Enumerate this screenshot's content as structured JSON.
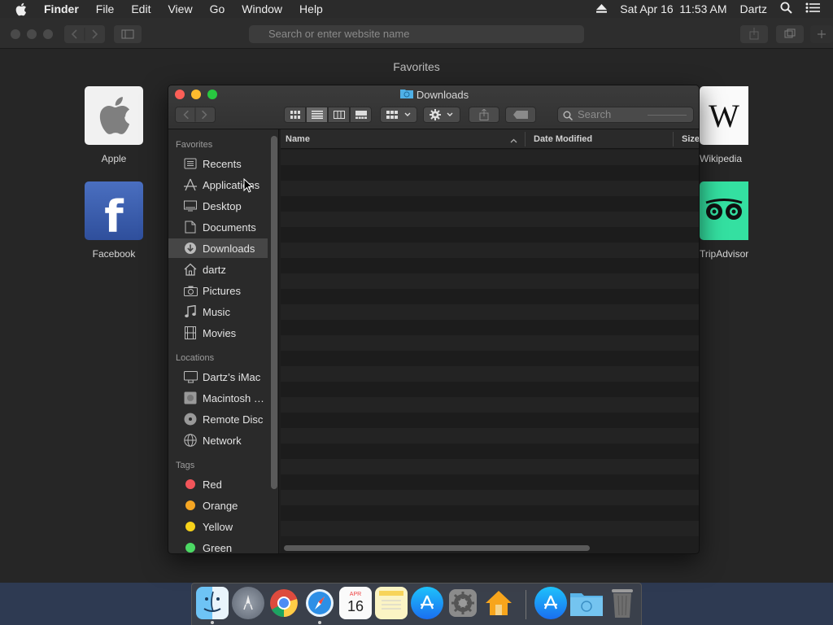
{
  "menubar": {
    "app_name": "Finder",
    "items": [
      "File",
      "Edit",
      "View",
      "Go",
      "Window",
      "Help"
    ],
    "datetime": "Sat Apr 16  11:53 AM",
    "user": "Dartz"
  },
  "safari": {
    "url_placeholder": "Search or enter website name",
    "favorites_title": "Favorites",
    "favorites": [
      {
        "label": "Apple",
        "icon": "apple-logo-icon"
      },
      {
        "label": "Facebook",
        "icon": "facebook-logo-icon"
      },
      {
        "label": "Wikipedia",
        "icon": "wikipedia-logo-icon"
      },
      {
        "label": "TripAdvisor",
        "icon": "tripadvisor-logo-icon"
      }
    ]
  },
  "finder": {
    "title": "Downloads",
    "search_placeholder": "Search",
    "columns": {
      "name": "Name",
      "date_modified": "Date Modified",
      "size": "Size"
    },
    "sidebar": {
      "favorites_header": "Favorites",
      "favorites": [
        {
          "label": "Recents",
          "icon": "recents-icon"
        },
        {
          "label": "Applications",
          "icon": "applications-icon"
        },
        {
          "label": "Desktop",
          "icon": "desktop-icon"
        },
        {
          "label": "Documents",
          "icon": "documents-icon"
        },
        {
          "label": "Downloads",
          "icon": "downloads-icon",
          "selected": true
        },
        {
          "label": "dartz",
          "icon": "home-icon"
        },
        {
          "label": "Pictures",
          "icon": "camera-icon"
        },
        {
          "label": "Music",
          "icon": "music-note-icon"
        },
        {
          "label": "Movies",
          "icon": "film-icon"
        }
      ],
      "locations_header": "Locations",
      "locations": [
        {
          "label": "Dartz’s iMac",
          "icon": "imac-icon"
        },
        {
          "label": "Macintosh HD",
          "icon": "hard-drive-icon"
        },
        {
          "label": "Remote Disc",
          "icon": "disc-icon"
        },
        {
          "label": "Network",
          "icon": "network-globe-icon"
        }
      ],
      "tags_header": "Tags",
      "tags": [
        {
          "label": "Red",
          "color": "#f2555a"
        },
        {
          "label": "Orange",
          "color": "#f5a623"
        },
        {
          "label": "Yellow",
          "color": "#f7d21a"
        },
        {
          "label": "Green",
          "color": "#4cd964"
        }
      ]
    }
  },
  "dock": {
    "items": [
      "finder-icon",
      "launchpad-icon",
      "chrome-icon",
      "safari-icon",
      "calendar-icon",
      "notes-icon",
      "app-store-icon",
      "system-preferences-icon",
      "home-app-icon",
      "app-store-downloads-icon",
      "downloads-folder-icon",
      "trash-icon"
    ],
    "calendar": {
      "month": "APR",
      "day": "16"
    }
  }
}
